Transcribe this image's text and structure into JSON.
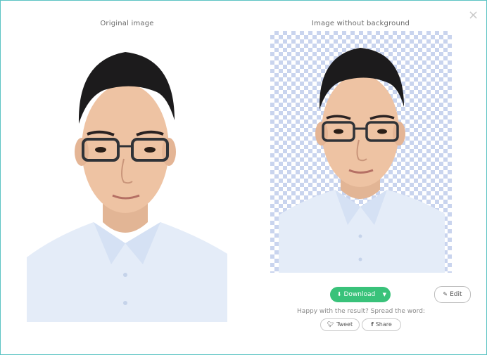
{
  "titles": {
    "original": "Original image",
    "no_background": "Image without background"
  },
  "icons": {
    "close": "close-icon",
    "download": "download-icon",
    "caret": "caret-down-icon",
    "edit": "pencil-icon",
    "twitter": "twitter-icon",
    "facebook": "facebook-icon"
  },
  "actions": {
    "download_label": "Download",
    "edit_label": "Edit",
    "happy_text": "Happy with the result? Spread the word:",
    "tweet_label": "Tweet",
    "share_label": "Share"
  },
  "colors": {
    "accent_green": "#39c27a",
    "modal_border": "#5cc3c4",
    "checker": "#c9d4ee"
  }
}
